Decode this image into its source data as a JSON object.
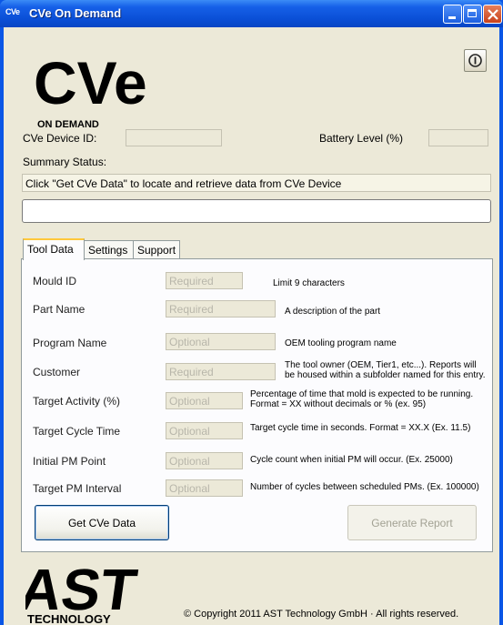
{
  "window": {
    "icon_text": "CVe",
    "title": "CVe On Demand"
  },
  "logos": {
    "cve_text": "CVe",
    "cve_sub": "ON DEMAND",
    "ast_text": "AST",
    "ast_sub": "TECHNOLOGY"
  },
  "header": {
    "device_id_label": "CVe Device ID:",
    "device_id_value": "",
    "battery_label": "Battery Level (%)",
    "battery_value": "",
    "summary_label": "Summary Status:",
    "summary_text": "Click \"Get CVe Data\" to locate and retrieve data from CVe Device",
    "progress": 0
  },
  "tabs": [
    {
      "label": "Tool Data",
      "active": true
    },
    {
      "label": "Settings",
      "active": false
    },
    {
      "label": "Support",
      "active": false
    }
  ],
  "fields": [
    {
      "label": "Mould ID",
      "placeholder": "Required",
      "hint": [
        "Limit 9 characters"
      ]
    },
    {
      "label": "Part Name",
      "placeholder": "Required",
      "hint": [
        "A description of the part"
      ]
    },
    {
      "label": "Program Name",
      "placeholder": "Optional",
      "hint": [
        "OEM tooling program name"
      ]
    },
    {
      "label": "Customer",
      "placeholder": "Required",
      "hint": [
        "The tool owner (OEM, Tier1, etc...). Reports will",
        "be housed within a subfolder named for this entry."
      ]
    },
    {
      "label": "Target Activity (%)",
      "placeholder": "Optional",
      "hint": [
        "Percentage of time that mold is expected to be running.",
        "Format = XX without decimals or % (ex. 95)"
      ]
    },
    {
      "label": "Target Cycle Time",
      "placeholder": "Optional",
      "hint": [
        "Target cycle time in seconds. Format = XX.X (Ex. 11.5)"
      ]
    },
    {
      "label": "Initial PM Point",
      "placeholder": "Optional",
      "hint": [
        "Cycle count when initial PM will occur. (Ex. 25000)"
      ]
    },
    {
      "label": "Target PM Interval",
      "placeholder": "Optional",
      "hint": [
        "Number of cycles between scheduled PMs. (Ex. 100000)"
      ]
    }
  ],
  "buttons": {
    "get_data": "Get CVe Data",
    "generate_report": "Generate Report",
    "info_icon": "info-icon"
  },
  "footer": {
    "copyright": "© Copyright 2011 AST Technology GmbH · All rights reserved."
  },
  "colors": {
    "title_bar": "#0a4fd6",
    "client_bg": "#ece9d8",
    "active_tab_accent": "#ffc83c"
  }
}
